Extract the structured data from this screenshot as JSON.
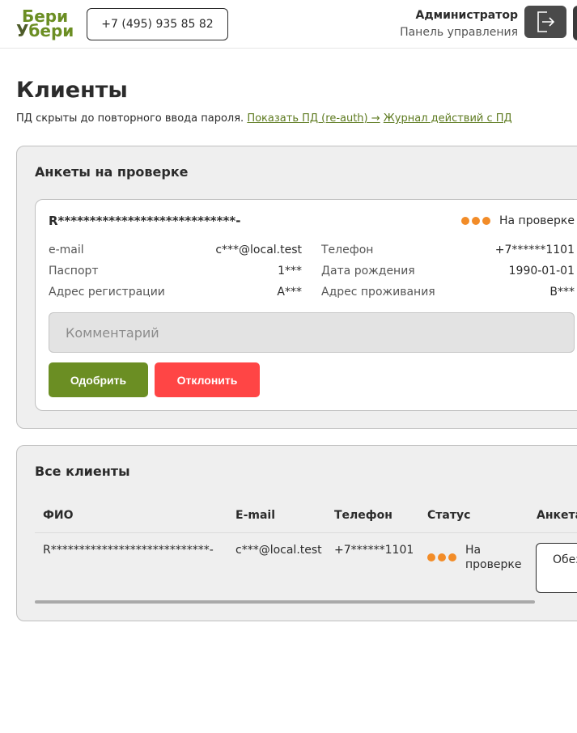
{
  "header": {
    "logo": {
      "line1": "Бери",
      "line2_accent": "У",
      "line2_rest": "бери"
    },
    "phone": "+7 (495) 935 85 82",
    "admin_name": "Администратор",
    "admin_subtitle": "Панель управления"
  },
  "page": {
    "title": "Клиенты",
    "notice_text": "ПД скрыты до повторного ввода пароля.",
    "show_pd_link": "Показать ПД (re-auth) →",
    "journal_link": "Журнал действий с ПД"
  },
  "review": {
    "title": "Анкеты на проверке",
    "card": {
      "name": "R****************************-",
      "status": "На проверке",
      "fields": {
        "email_label": "e-mail",
        "email_value": "c***@local.test",
        "phone_label": "Телефон",
        "phone_value": "+7******1101",
        "passport_label": "Паспорт",
        "passport_value": "1***",
        "birth_label": "Дата рождения",
        "birth_value": "1990-01-01",
        "reg_label": "Адрес регистрации",
        "reg_value": "A***",
        "live_label": "Адрес проживания",
        "live_value": "B***"
      },
      "comment_placeholder": "Комментарий",
      "approve_label": "Одобрить",
      "reject_label": "Отклонить"
    }
  },
  "clients": {
    "title": "Все клиенты",
    "columns": [
      "ФИО",
      "E-mail",
      "Телефон",
      "Статус",
      "Анкета"
    ],
    "rows": [
      {
        "name": "R****************************-",
        "email": "c***@local.test",
        "phone": "+7******1101",
        "status_line1": "На",
        "status_line2": "проверке",
        "action": "Обез"
      }
    ]
  },
  "colors": {
    "accent": "#6b8e23",
    "reject": "#ff4545",
    "status_dot": "#f28c28"
  },
  "icons": {
    "logout": "logout-icon",
    "status": "status-dots-icon"
  }
}
